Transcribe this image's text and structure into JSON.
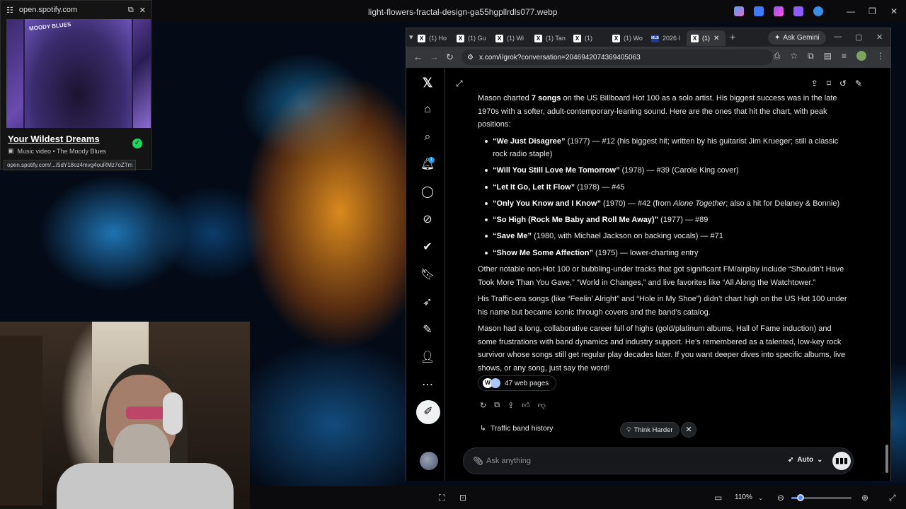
{
  "desktop": {
    "window_title": "light-flowers-fractal-design-ga55hgpllrdls077.webp"
  },
  "spotify_pip": {
    "domain": "open.spotify.com",
    "album_art_text": "MOODY BLUES",
    "title": "Your Wildest Dreams",
    "subtitle": "Music video • The Moody Blues",
    "status_url": "open.spotify.com/.../5dY18oz4mvg4ouRMz7oZTm"
  },
  "browser": {
    "tabs": [
      {
        "label": "(1) Ho",
        "favicon": "X"
      },
      {
        "label": "(1) Gu",
        "favicon": "X"
      },
      {
        "label": "(1) Wi",
        "favicon": "X"
      },
      {
        "label": "(1) Tan",
        "favicon": "X"
      },
      {
        "label": "(1) ",
        "favicon": "X"
      },
      {
        "label": "(1) Wo",
        "favicon": "X"
      },
      {
        "label": "2026 I",
        "favicon": "MLB"
      },
      {
        "label": "(1)",
        "favicon": "X"
      }
    ],
    "gemini_label": "Ask Gemini",
    "url": "x.com/i/grok?conversation=2046942074369405063"
  },
  "grok": {
    "intro_pre": "Mason charted ",
    "intro_bold": "7 songs",
    "intro_post": " on the US Billboard Hot 100 as a solo artist. His biggest success was in the late 1970s with a softer, adult-contemporary-leaning sound. Here are the ones that hit the chart, with peak positions:",
    "songs": [
      {
        "title": "“We Just Disagree”",
        "detail": " (1977) — #12 (his biggest hit; written by his guitarist Jim Krueger; still a classic rock radio staple)"
      },
      {
        "title": "“Will You Still Love Me Tomorrow”",
        "detail": " (1978) — #39 (Carole King cover)"
      },
      {
        "title": "“Let It Go, Let It Flow”",
        "detail": " (1978) — #45"
      },
      {
        "title": "“Only You Know and I Know”",
        "detail": " (1970) — #42 (from ",
        "italic": "Alone Together",
        "detail2": "; also a hit for Delaney & Bonnie)"
      },
      {
        "title": "“So High (Rock Me Baby and Roll Me Away)”",
        "detail": " (1977) — #89"
      },
      {
        "title": "“Save Me”",
        "detail": " (1980, with Michael Jackson on backing vocals) — #71"
      },
      {
        "title": "“Show Me Some Affection”",
        "detail": " (1975) — lower-charting entry"
      }
    ],
    "para2": "Other notable non-Hot 100 or bubbling-under tracks that got significant FM/airplay include “Shouldn’t Have Took More Than You Gave,” “World in Changes,” and live favorites like “All Along the Watchtower.”",
    "para3": "His Traffic-era songs (like “Feelin’ Alright” and “Hole in My Shoe”) didn’t chart high on the US Hot 100 under his name but became iconic through covers and the band’s catalog.",
    "para4": "Mason had a long, collaborative career full of highs (gold/platinum albums, Hall of Fame induction) and some frustrations with band dynamics and industry support. He’s remembered as a talented, low-key rock survivor whose songs still get regular play decades later. If you want deeper dives into specific albums, live shows, or any song, just say the word!",
    "sources_label": "47 web pages",
    "source_icon_letter": "W",
    "followup": "Traffic band history",
    "think_harder": "Think Harder",
    "input_placeholder": "Ask anything",
    "mode": "Auto",
    "notification_count": "1"
  },
  "viewer": {
    "zoom": "110%",
    "zoom_fraction": 0.15
  },
  "colors": {
    "accent": "#1d9bf0",
    "spotify_green": "#1ed760",
    "x_background": "#000000"
  }
}
